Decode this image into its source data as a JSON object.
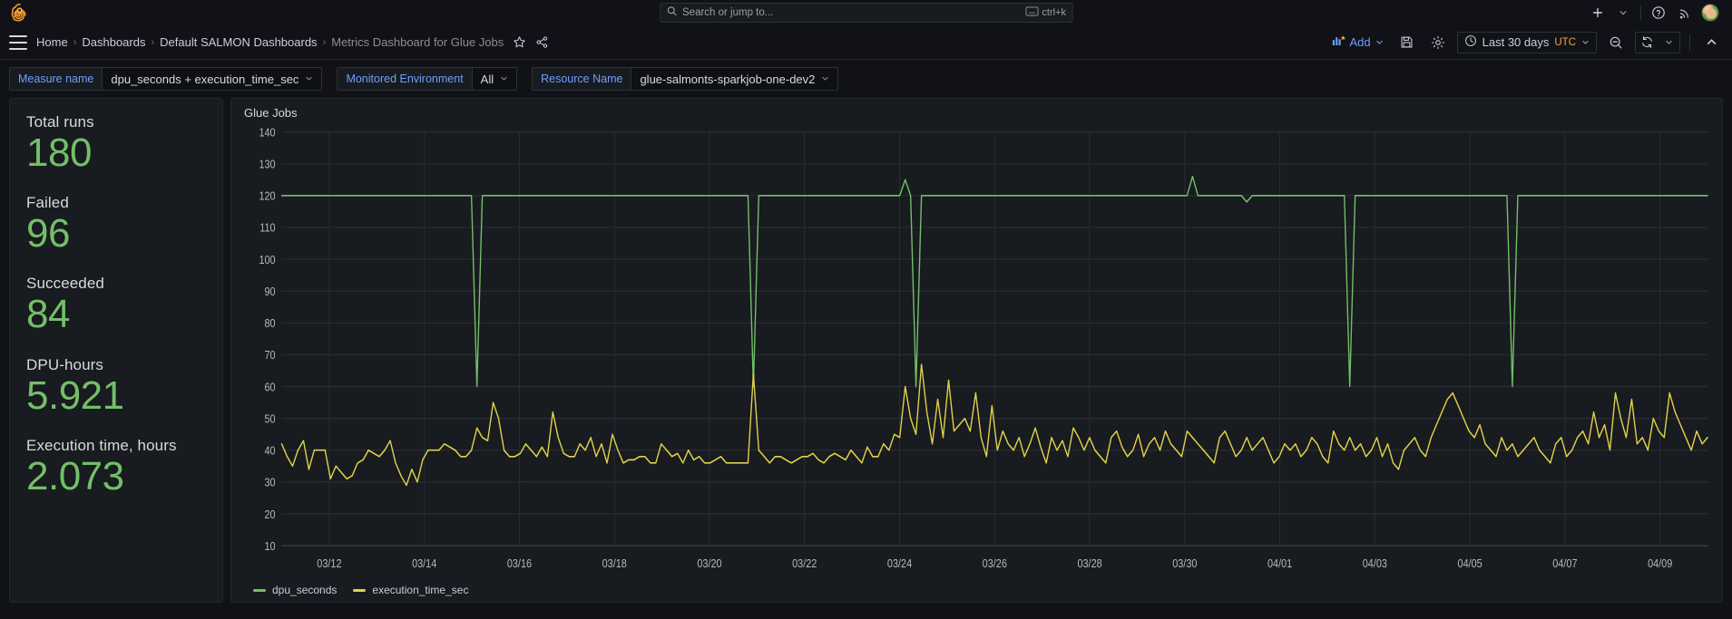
{
  "topnav": {
    "logo_icon": "grafana-logo-icon",
    "search": {
      "placeholder": "Search or jump to...",
      "shortcut": "ctrl+k",
      "icon": "search-icon",
      "kbd_icon": "keyboard-icon"
    },
    "add_icon": "plus-icon",
    "add_chevron_icon": "chevron-down-icon",
    "help_icon": "help-circle-icon",
    "news_icon": "rss-icon",
    "avatar": "user-avatar"
  },
  "breadcrumb": {
    "menu_icon": "hamburger-menu-icon",
    "items": [
      {
        "label": "Home",
        "current": false
      },
      {
        "label": "Dashboards",
        "current": false
      },
      {
        "label": "Default SALMON Dashboards",
        "current": false
      },
      {
        "label": "Metrics Dashboard for Glue Jobs",
        "current": true
      }
    ],
    "separator": "›",
    "star_icon": "star-outline-icon",
    "share_icon": "share-nodes-icon"
  },
  "toolbar": {
    "add_label": "Add",
    "add_icon": "panel-add-icon",
    "add_chevron_icon": "chevron-down-icon",
    "save_icon": "save-disk-icon",
    "settings_icon": "gear-icon",
    "time_range": "Last 30 days",
    "timezone": "UTC",
    "clock_icon": "clock-icon",
    "time_chevron_icon": "chevron-down-icon",
    "zoom_out_icon": "zoom-out-icon",
    "refresh_icon": "refresh-icon",
    "refresh_chevron_icon": "chevron-down-icon",
    "collapse_icon": "chevron-up-icon"
  },
  "variables": [
    {
      "label": "Measure name",
      "value": "dpu_seconds + execution_time_sec",
      "chevron_icon": "chevron-down-icon"
    },
    {
      "label": "Monitored Environment",
      "value": "All",
      "chevron_icon": "chevron-down-icon"
    },
    {
      "label": "Resource Name",
      "value": "glue-salmonts-sparkjob-one-dev2",
      "chevron_icon": "chevron-down-icon"
    }
  ],
  "stats_panel": {
    "items": [
      {
        "title": "Total runs",
        "value": "180"
      },
      {
        "title": "Failed",
        "value": "96"
      },
      {
        "title": "Succeeded",
        "value": "84"
      },
      {
        "title": "DPU-hours",
        "value": "5.921"
      },
      {
        "title": "Execution time, hours",
        "value": "2.073"
      }
    ],
    "value_color": "#73bf69"
  },
  "graph_panel": {
    "title": "Glue Jobs"
  },
  "chart_data": {
    "type": "line",
    "title": "Glue Jobs",
    "xlabel": "",
    "ylabel": "",
    "ylim": [
      10,
      140
    ],
    "yticks": [
      10,
      20,
      30,
      40,
      50,
      60,
      70,
      80,
      90,
      100,
      110,
      120,
      130,
      140
    ],
    "xticks": [
      "03/12",
      "03/14",
      "03/16",
      "03/18",
      "03/20",
      "03/22",
      "03/24",
      "03/26",
      "03/28",
      "03/30",
      "04/01",
      "04/03",
      "04/05",
      "04/07",
      "04/09"
    ],
    "grid": true,
    "legend_position": "bottom",
    "colors": {
      "dpu_seconds": "#73bf69",
      "execution_time_sec": "#e0d24a"
    },
    "series": [
      {
        "name": "dpu_seconds",
        "color": "#73bf69",
        "values": [
          120,
          120,
          120,
          120,
          120,
          120,
          120,
          120,
          120,
          120,
          120,
          120,
          120,
          120,
          120,
          120,
          120,
          120,
          120,
          120,
          120,
          120,
          120,
          120,
          120,
          120,
          120,
          120,
          120,
          120,
          120,
          120,
          120,
          120,
          120,
          120,
          60,
          120,
          120,
          120,
          120,
          120,
          120,
          120,
          120,
          120,
          120,
          120,
          120,
          120,
          120,
          120,
          120,
          120,
          120,
          120,
          120,
          120,
          120,
          120,
          120,
          120,
          120,
          120,
          120,
          120,
          120,
          120,
          120,
          120,
          120,
          120,
          120,
          120,
          120,
          120,
          120,
          120,
          120,
          120,
          120,
          120,
          120,
          120,
          120,
          120,
          120,
          60,
          120,
          120,
          120,
          120,
          120,
          120,
          120,
          120,
          120,
          120,
          120,
          120,
          120,
          120,
          120,
          120,
          120,
          120,
          120,
          120,
          120,
          120,
          120,
          120,
          120,
          120,
          120,
          125,
          120,
          60,
          120,
          120,
          120,
          120,
          120,
          120,
          120,
          120,
          120,
          120,
          120,
          120,
          120,
          120,
          120,
          120,
          120,
          120,
          120,
          120,
          120,
          120,
          120,
          120,
          120,
          120,
          120,
          120,
          120,
          120,
          120,
          120,
          120,
          120,
          120,
          120,
          120,
          120,
          120,
          120,
          120,
          120,
          120,
          120,
          120,
          120,
          120,
          120,
          120,
          120,
          126,
          120,
          120,
          120,
          120,
          120,
          120,
          120,
          120,
          120,
          118,
          120,
          120,
          120,
          120,
          120,
          120,
          120,
          120,
          120,
          120,
          120,
          120,
          120,
          120,
          120,
          120,
          120,
          120,
          60,
          120,
          120,
          120,
          120,
          120,
          120,
          120,
          120,
          120,
          120,
          120,
          120,
          120,
          120,
          120,
          120,
          120,
          120,
          120,
          120,
          120,
          120,
          120,
          120,
          120,
          120,
          120,
          120,
          120,
          60,
          120,
          120,
          120,
          120,
          120,
          120,
          120,
          120,
          120,
          120,
          120,
          120,
          120,
          120,
          120,
          120,
          120,
          120,
          120,
          120,
          120,
          120,
          120,
          120,
          120,
          120,
          120,
          120,
          120,
          120,
          120,
          120,
          120,
          120,
          120,
          120
        ]
      },
      {
        "name": "execution_time_sec",
        "color": "#e0d24a",
        "values": [
          42,
          38,
          35,
          40,
          43,
          34,
          40,
          40,
          40,
          31,
          35,
          33,
          31,
          32,
          36,
          37,
          40,
          39,
          38,
          40,
          43,
          36,
          32,
          29,
          34,
          30,
          37,
          40,
          40,
          40,
          42,
          41,
          40,
          38,
          38,
          40,
          47,
          44,
          43,
          55,
          50,
          40,
          38,
          38,
          39,
          42,
          40,
          38,
          41,
          38,
          52,
          44,
          39,
          38,
          38,
          42,
          40,
          44,
          38,
          42,
          36,
          45,
          40,
          36,
          37,
          37,
          38,
          38,
          36,
          36,
          42,
          40,
          38,
          39,
          36,
          40,
          37,
          38,
          36,
          36,
          37,
          38,
          36,
          36,
          36,
          36,
          36,
          64,
          40,
          38,
          36,
          38,
          38,
          37,
          36,
          37,
          38,
          38,
          39,
          37,
          36,
          38,
          39,
          38,
          37,
          40,
          38,
          36,
          41,
          38,
          38,
          42,
          40,
          45,
          44,
          60,
          50,
          45,
          67,
          52,
          42,
          56,
          44,
          62,
          46,
          48,
          50,
          46,
          58,
          44,
          38,
          54,
          40,
          46,
          42,
          40,
          44,
          38,
          42,
          47,
          41,
          36,
          44,
          40,
          43,
          38,
          47,
          44,
          40,
          44,
          40,
          38,
          36,
          44,
          46,
          41,
          38,
          40,
          45,
          38,
          42,
          44,
          40,
          46,
          42,
          40,
          38,
          46,
          44,
          42,
          40,
          38,
          36,
          44,
          46,
          42,
          38,
          40,
          44,
          40,
          42,
          44,
          40,
          36,
          38,
          42,
          40,
          42,
          38,
          40,
          44,
          42,
          38,
          36,
          46,
          42,
          40,
          44,
          40,
          42,
          38,
          40,
          44,
          38,
          42,
          36,
          34,
          40,
          42,
          44,
          40,
          38,
          44,
          48,
          52,
          56,
          58,
          54,
          50,
          46,
          44,
          48,
          42,
          40,
          38,
          44,
          40,
          42,
          38,
          40,
          42,
          44,
          40,
          38,
          36,
          42,
          44,
          38,
          40,
          44,
          46,
          42,
          52,
          44,
          48,
          40,
          58,
          50,
          44,
          56,
          42,
          44,
          40,
          50,
          46,
          44,
          58,
          52,
          48,
          44,
          40,
          46,
          42,
          44
        ]
      }
    ]
  }
}
